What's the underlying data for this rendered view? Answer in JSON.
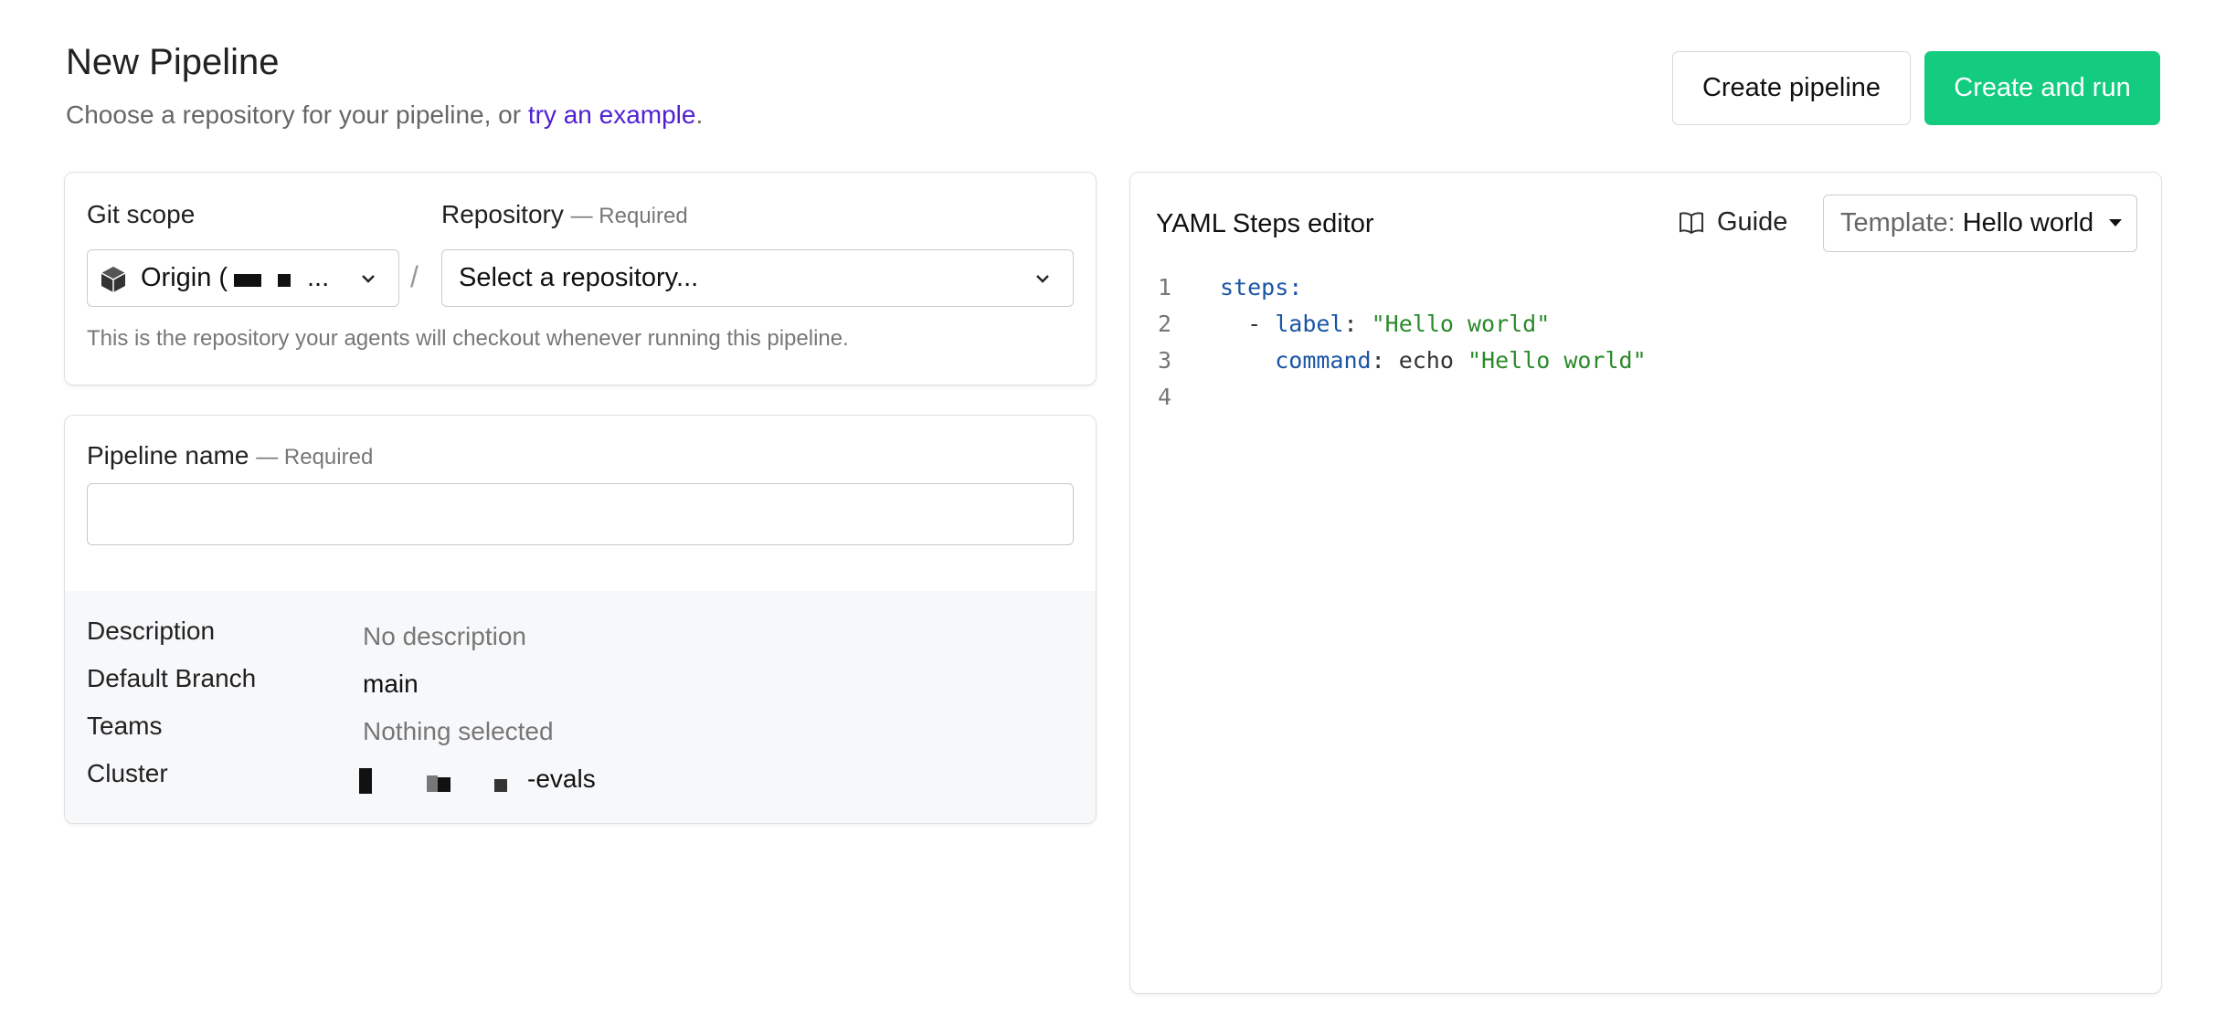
{
  "header": {
    "title": "New Pipeline",
    "subtitle_prefix": "Choose a repository for your pipeline, or ",
    "subtitle_link": "try an example",
    "subtitle_suffix": ".",
    "create_pipeline_label": "Create pipeline",
    "create_and_run_label": "Create and run"
  },
  "repo_card": {
    "git_scope_label": "Git scope",
    "git_scope_value": "Origin (",
    "git_scope_ellipsis": "...",
    "separator": "/",
    "repository_label": "Repository",
    "repository_required": "— Required",
    "repository_placeholder": "Select a repository...",
    "hint": "This is the repository your agents will checkout whenever running this pipeline."
  },
  "pipeline_card": {
    "name_label": "Pipeline name",
    "name_required": "— Required",
    "name_value": "",
    "details": [
      {
        "key": "Description",
        "value": "No description"
      },
      {
        "key": "Default Branch",
        "value": "main"
      },
      {
        "key": "Teams",
        "value": "Nothing selected"
      },
      {
        "key": "Cluster",
        "value": "-evals"
      }
    ]
  },
  "yaml_editor": {
    "title": "YAML Steps editor",
    "guide_label": "Guide",
    "template_prefix": "Template:",
    "template_value": "Hello world",
    "line_numbers": [
      "1",
      "2",
      "3",
      "4"
    ],
    "line1_key": "steps",
    "line2_dash": "- ",
    "line2_key": "label",
    "line2_value": "\"Hello world\"",
    "line3_key": "command",
    "line3_cmd": "echo ",
    "line3_value": "\"Hello world\"",
    "colon": ":"
  },
  "colors": {
    "primary_button": "#14cc80",
    "link": "#4f1fd1",
    "yaml_key": "#1a55a5",
    "yaml_string": "#2a8a2a"
  },
  "icons": {
    "git_scope": "cube-icon",
    "dropdown": "chevron-down-icon",
    "guide": "book-icon",
    "template": "caret-down-icon"
  }
}
